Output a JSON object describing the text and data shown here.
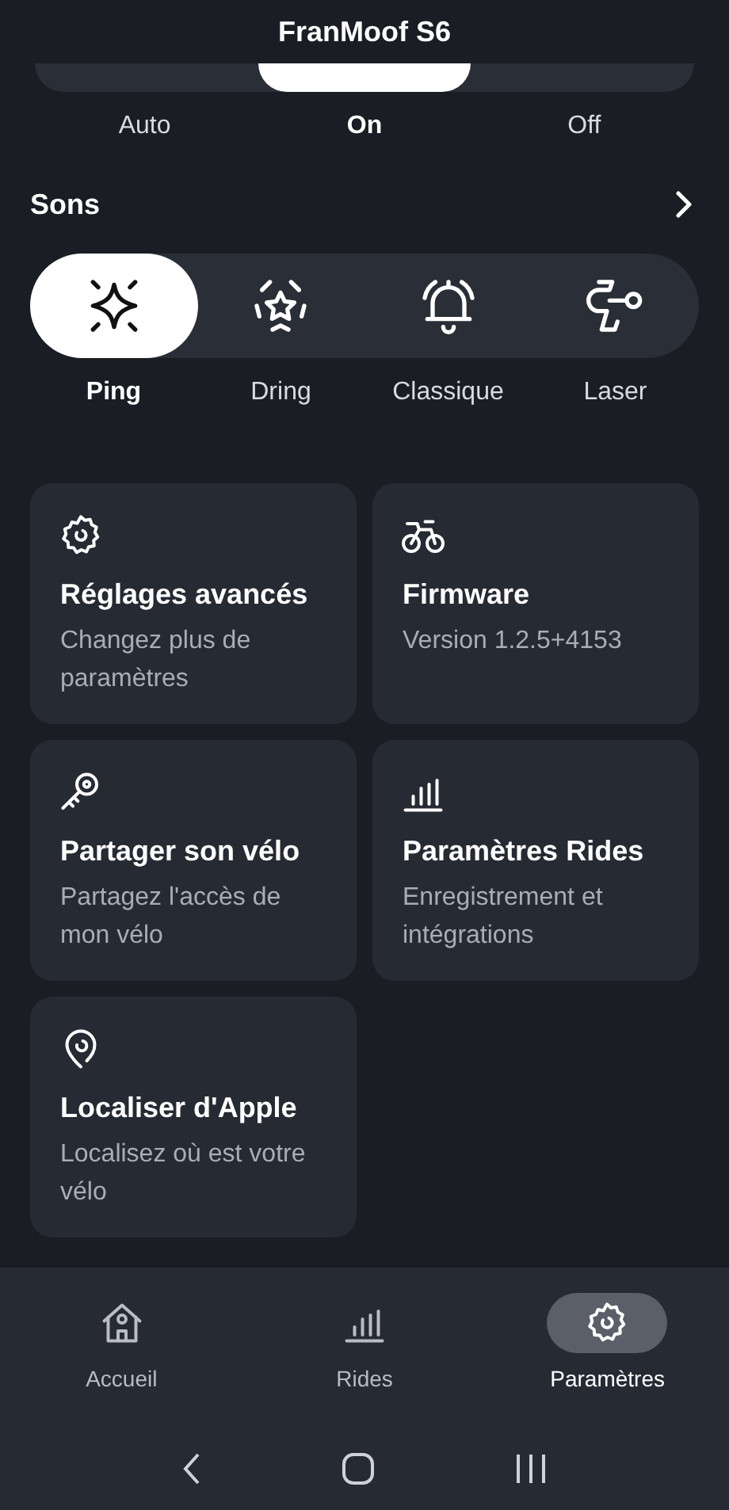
{
  "header": {
    "title": "FranMoof S6"
  },
  "light_modes": [
    {
      "label": "Auto",
      "selected": false
    },
    {
      "label": "On",
      "selected": true
    },
    {
      "label": "Off",
      "selected": false
    }
  ],
  "sounds": {
    "title": "Sons",
    "items": [
      {
        "label": "Ping",
        "selected": true
      },
      {
        "label": "Dring",
        "selected": false
      },
      {
        "label": "Classique",
        "selected": false
      },
      {
        "label": "Laser",
        "selected": false
      }
    ]
  },
  "tiles": [
    {
      "title": "Réglages avancés",
      "subtitle": "Changez plus de paramètres"
    },
    {
      "title": "Firmware",
      "subtitle": "Version 1.2.5+4153"
    },
    {
      "title": "Partager son vélo",
      "subtitle": "Partagez l'accès de mon vélo"
    },
    {
      "title": "Paramètres Rides",
      "subtitle": "Enregistrement et intégrations"
    },
    {
      "title": "Localiser d'Apple",
      "subtitle": "Localisez où est votre vélo"
    }
  ],
  "bottom_nav": [
    {
      "label": "Accueil",
      "selected": false
    },
    {
      "label": "Rides",
      "selected": false
    },
    {
      "label": "Paramètres",
      "selected": true
    }
  ]
}
